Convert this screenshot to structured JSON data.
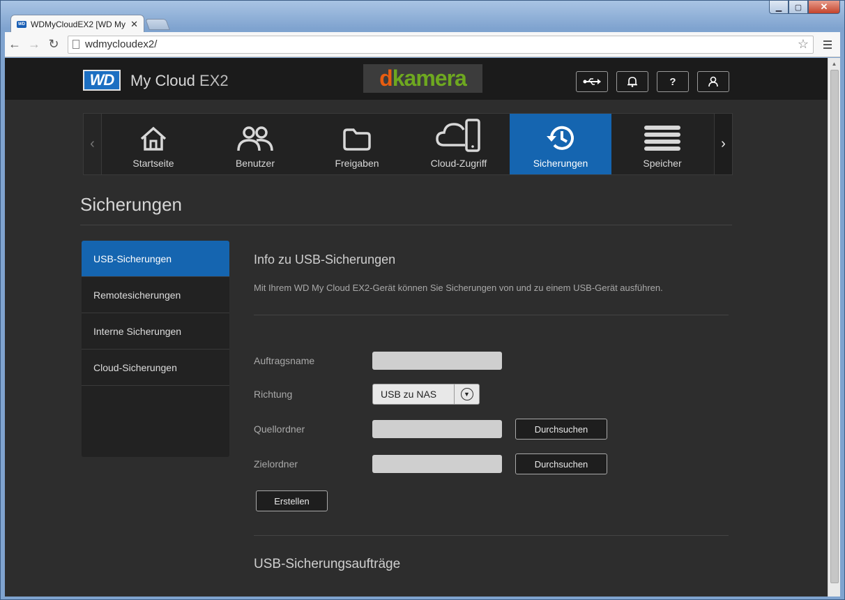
{
  "browser": {
    "tab_title": "WDMyCloudEX2 [WD My",
    "tab_close": "✕",
    "url": "wdmycloudex2/"
  },
  "header": {
    "brand_logo": "WD",
    "product_name": "My Cloud",
    "product_model": "EX2",
    "watermark_d": "d",
    "watermark_rest": "kamera",
    "buttons": [
      "usb-icon",
      "bell-icon",
      "help-icon",
      "user-icon"
    ],
    "help_label": "?"
  },
  "nav": {
    "items": [
      {
        "label": "Startseite",
        "icon": "home-icon"
      },
      {
        "label": "Benutzer",
        "icon": "users-icon"
      },
      {
        "label": "Freigaben",
        "icon": "folder-icon"
      },
      {
        "label": "Cloud-Zugriff",
        "icon": "cloud-device-icon"
      },
      {
        "label": "Sicherungen",
        "icon": "history-icon",
        "active": true
      },
      {
        "label": "Speicher",
        "icon": "storage-icon"
      }
    ],
    "active_color": "#1565b0"
  },
  "page": {
    "title": "Sicherungen"
  },
  "sidebar": {
    "items": [
      {
        "label": "USB-Sicherungen",
        "active": true
      },
      {
        "label": "Remotesicherungen"
      },
      {
        "label": "Interne Sicherungen"
      },
      {
        "label": "Cloud-Sicherungen"
      }
    ]
  },
  "main": {
    "info_title": "Info zu USB-Sicherungen",
    "info_desc": "Mit Ihrem WD My Cloud EX2-Gerät können Sie Sicherungen von und zu einem USB-Gerät ausführen.",
    "form": {
      "job_name_label": "Auftragsname",
      "job_name_value": "",
      "direction_label": "Richtung",
      "direction_value": "USB zu NAS",
      "source_label": "Quellordner",
      "source_value": "",
      "target_label": "Zielordner",
      "target_value": "",
      "browse_label": "Durchsuchen",
      "create_label": "Erstellen"
    },
    "jobs_title": "USB-Sicherungsaufträge"
  }
}
